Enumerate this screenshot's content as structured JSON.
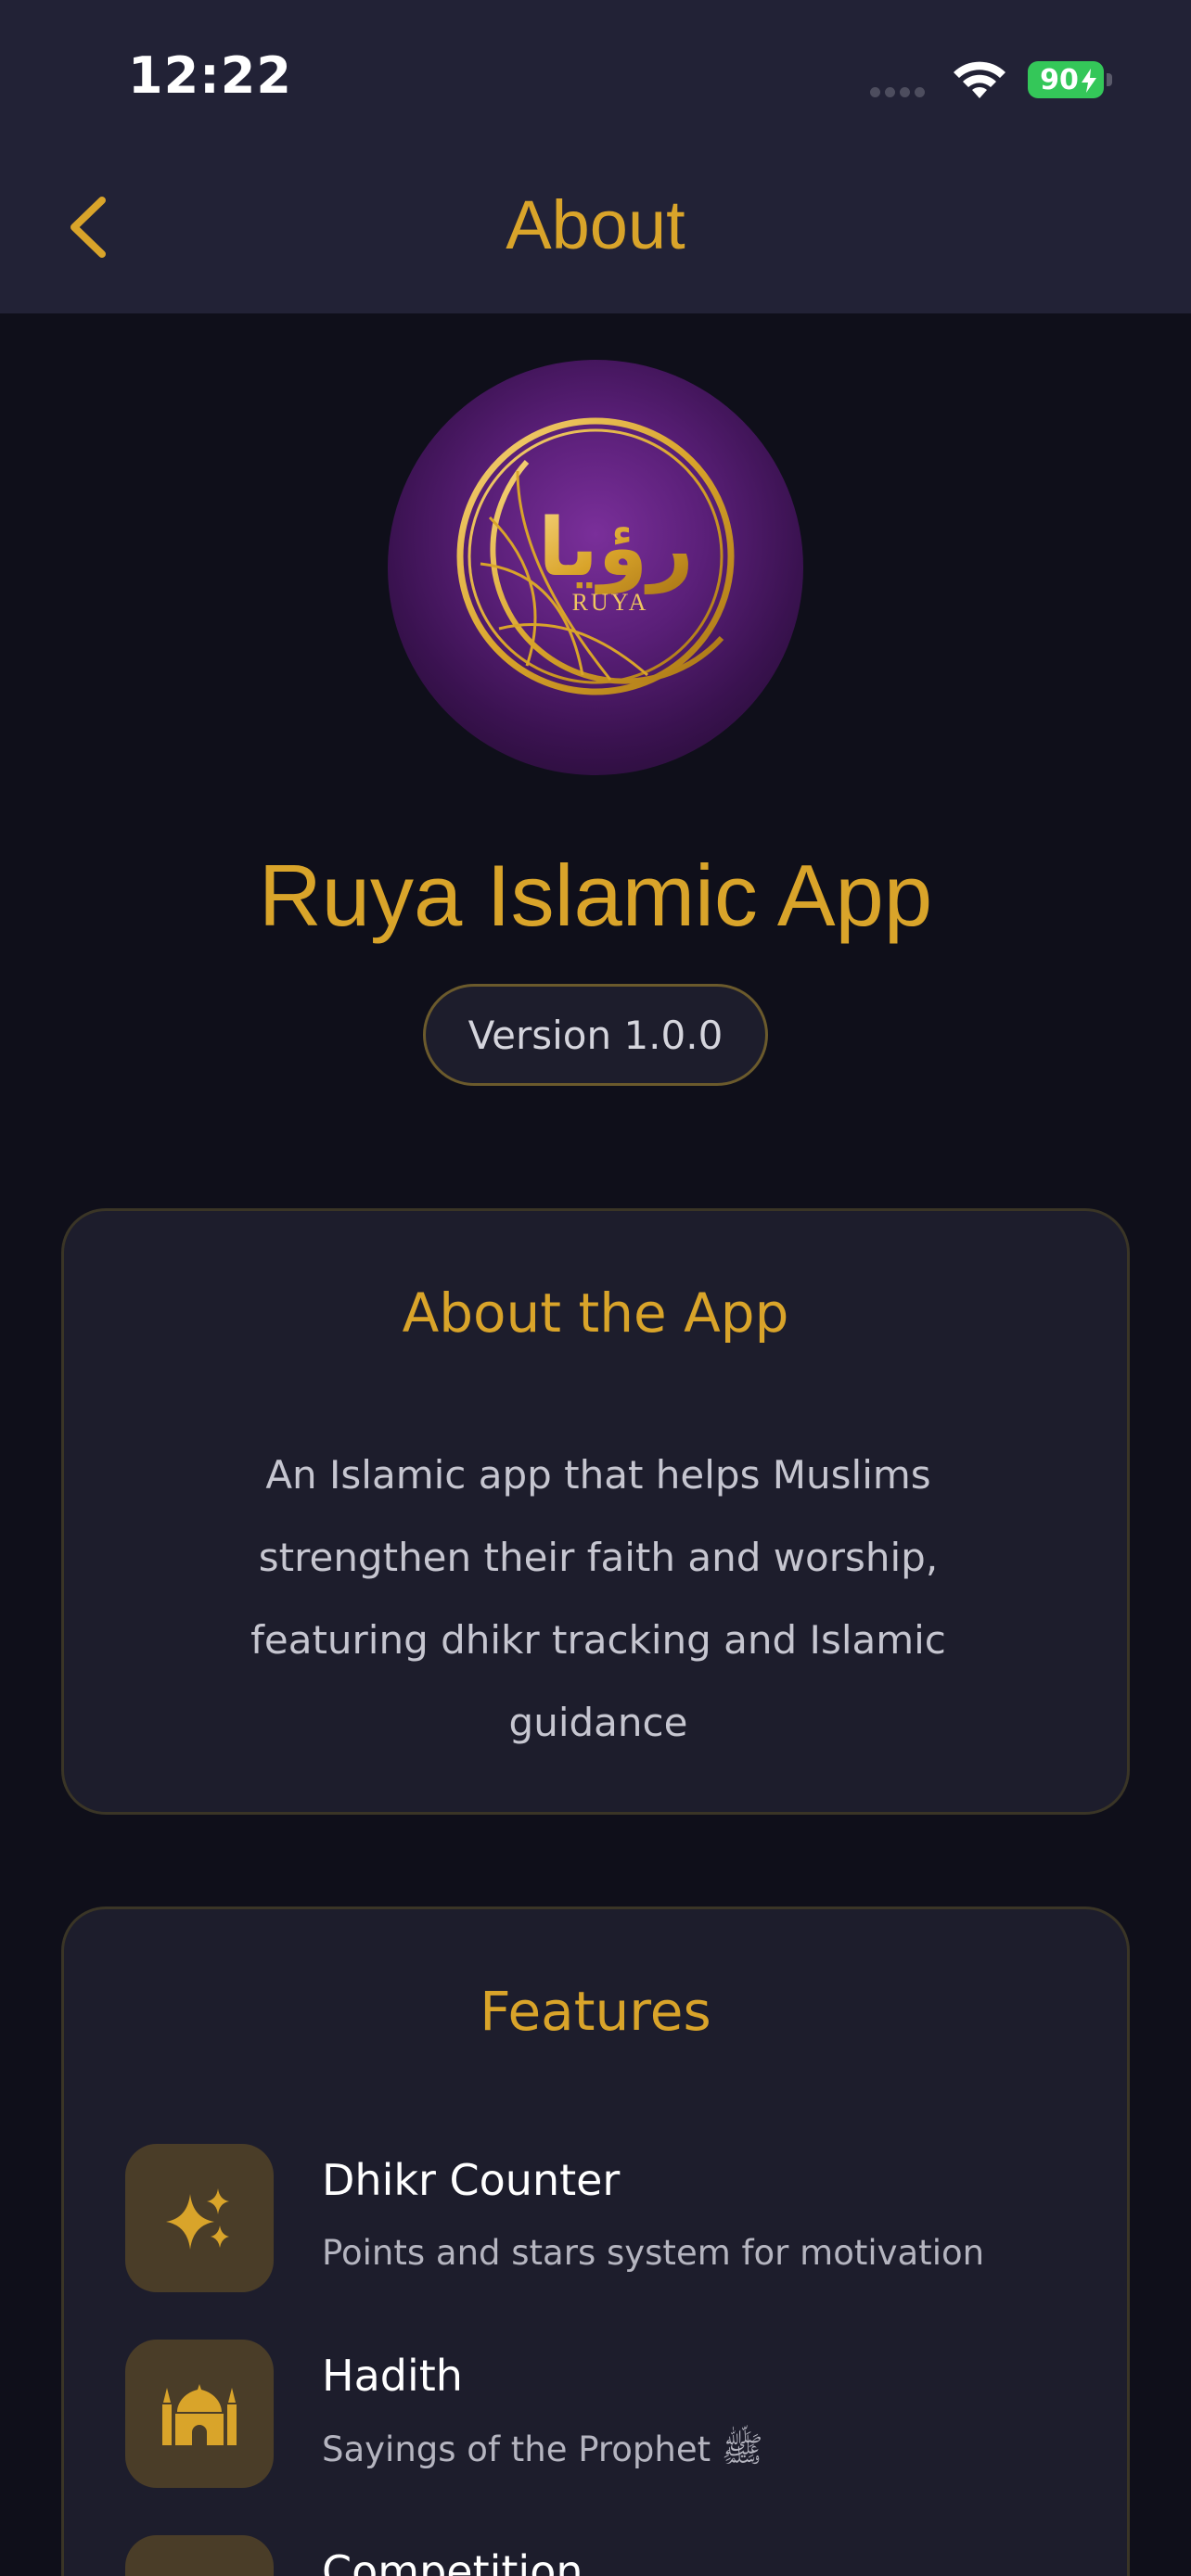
{
  "status_bar": {
    "time": "12:22",
    "battery": "90"
  },
  "nav": {
    "title": "About"
  },
  "logo": {
    "arabic": "رؤيا",
    "latin": "RUYA"
  },
  "app": {
    "name": "Ruya Islamic App",
    "version": "Version 1.0.0"
  },
  "about_card": {
    "title": "About the App",
    "text": "An Islamic app that helps Muslims strengthen their faith and worship, featuring dhikr tracking and Islamic guidance"
  },
  "features_card": {
    "title": "Features",
    "items": [
      {
        "name": "Dhikr Counter",
        "description": "Points and stars system for motivation",
        "icon": "sparkles-icon"
      },
      {
        "name": "Hadith",
        "description": "Sayings of the Prophet ﷺ",
        "icon": "mosque-icon"
      },
      {
        "name": "Competition",
        "description": "",
        "icon": "trophy-icon"
      }
    ]
  },
  "colors": {
    "accent": "#d9a42a",
    "header_bg": "#222236",
    "page_bg": "#0f0f1a",
    "card_bg": "#1d1d2c",
    "battery": "#34c759"
  }
}
